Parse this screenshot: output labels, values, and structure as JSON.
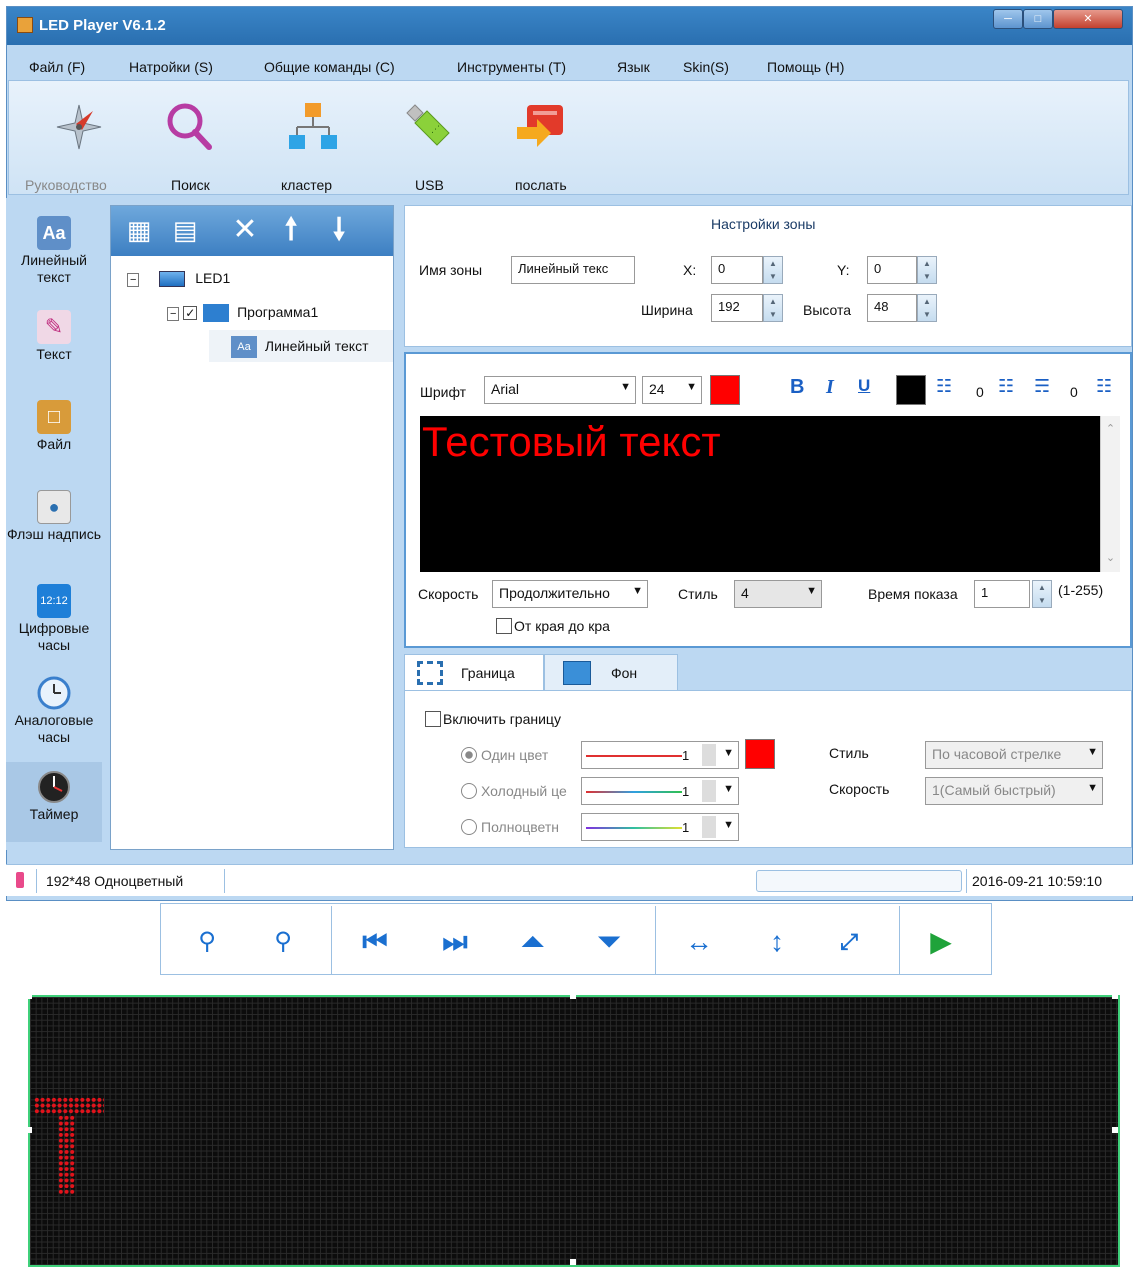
{
  "window": {
    "title": "LED Player V6.1.2"
  },
  "menu": {
    "items": [
      "Файл (F)",
      "Натройки (S)",
      "Общие команды (C)",
      "Инструменты (T)",
      "Язык",
      "Skin(S)",
      "Помощь (H)"
    ]
  },
  "toolbar": {
    "buttons": [
      {
        "label": "Руководство",
        "icon": "compass-icon"
      },
      {
        "label": "Поиск",
        "icon": "magnifier-icon"
      },
      {
        "label": "кластер",
        "icon": "network-icon"
      },
      {
        "label": "USB",
        "icon": "usb-drive-icon"
      },
      {
        "label": "послать",
        "icon": "send-icon"
      }
    ]
  },
  "sidebar": {
    "items": [
      {
        "label": "Линейный текст",
        "icon": "linear-text-icon"
      },
      {
        "label": "Текст",
        "icon": "text-icon"
      },
      {
        "label": "Файл",
        "icon": "file-icon"
      },
      {
        "label": "Флэш надпись",
        "icon": "flash-icon"
      },
      {
        "label": "Цифровые часы",
        "icon": "digital-clock-icon",
        "clock_text": "12:12"
      },
      {
        "label": "Аналоговые часы",
        "icon": "analog-clock-icon"
      },
      {
        "label": "Таймер",
        "icon": "timer-icon"
      }
    ]
  },
  "tree": {
    "nodes": [
      {
        "label": "LED1",
        "type": "screen"
      },
      {
        "label": "Программа1",
        "type": "program"
      },
      {
        "label": "Линейный текст",
        "type": "zone"
      }
    ]
  },
  "zone": {
    "title": "Настройки зоны",
    "name_label": "Имя зоны",
    "name_value": "Линейный текс",
    "x_label": "X:",
    "x_value": "0",
    "y_label": "Y:",
    "y_value": "0",
    "width_label": "Ширина",
    "width_value": "192",
    "height_label": "Высота",
    "height_value": "48"
  },
  "editor": {
    "font_label": "Шрифт",
    "font_value": "Arial",
    "size_value": "24",
    "text_color": "#ff0000",
    "bg_color": "#000000",
    "bold": "B",
    "italic": "I",
    "underline": "U",
    "spacing_1": "0",
    "spacing_2": "0",
    "content": "Тестовый текст",
    "speed_label": "Скорость",
    "speed_value": "Продолжительно",
    "style_label": "Стиль",
    "style_value": "4",
    "time_label": "Время показа",
    "time_value": "1",
    "time_range": "(1-255)",
    "edge_label": "От края до кра"
  },
  "tabs": {
    "border": "Граница",
    "background": "Фон"
  },
  "border": {
    "enable_label": "Включить границу",
    "single_color": "Один цвет",
    "cold_color": "Холодный це",
    "full_color": "Полноцветн",
    "line_value": "1",
    "border_color": "#ff0000",
    "style_label": "Стиль",
    "style_value": "По часовой стрелке",
    "speed_label": "Скорость",
    "speed_value": "1(Самый быстрый)"
  },
  "status": {
    "screen_info": "192*48 Одноцветный",
    "datetime": "2016-09-21 10:59:10"
  },
  "preview": {
    "buttons": [
      "zoom-in-icon",
      "zoom-out-icon",
      "first-icon",
      "last-icon",
      "top-icon",
      "bottom-icon",
      "fit-width-icon",
      "fit-height-icon",
      "fullscreen-icon",
      "play-icon"
    ],
    "led_color": "#e3131b",
    "border_color": "#3fd07a"
  }
}
